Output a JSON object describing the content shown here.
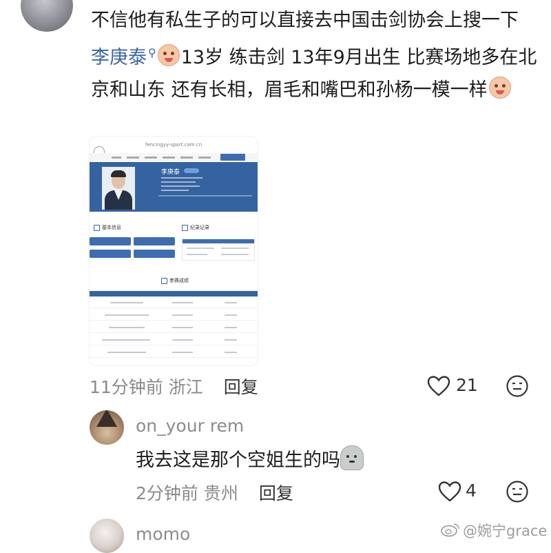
{
  "comment": {
    "text_part1": "不信他有私生子的可以直接去中国击剑协会上搜一下 ",
    "mention": "李庚泰",
    "text_part2": "13岁 练击剑 13年9月出生 比赛场地多在北京和山东 还有长相，眉毛和嘴巴和孙杨一模一样",
    "time": "11分钟前",
    "location": "浙江",
    "reply_label": "回复",
    "likes": "21",
    "icons": [
      "search-icon",
      "crying-emoji",
      "heart-icon",
      "emoji-reaction-icon"
    ]
  },
  "screenshot": {
    "url": "fencingyy-sport.com.cn",
    "athlete_name": "李庚泰",
    "section_basic": "基本信息",
    "section_record": "纪录记录",
    "section_results": "参赛成绩"
  },
  "reply1": {
    "username": "on_your rem",
    "text": "我去这是那个空姐生的吗",
    "time": "2分钟前",
    "location": "贵州",
    "reply_label": "回复",
    "likes": "4"
  },
  "reply2": {
    "username": "momo"
  },
  "watermark": "@婉宁grace"
}
